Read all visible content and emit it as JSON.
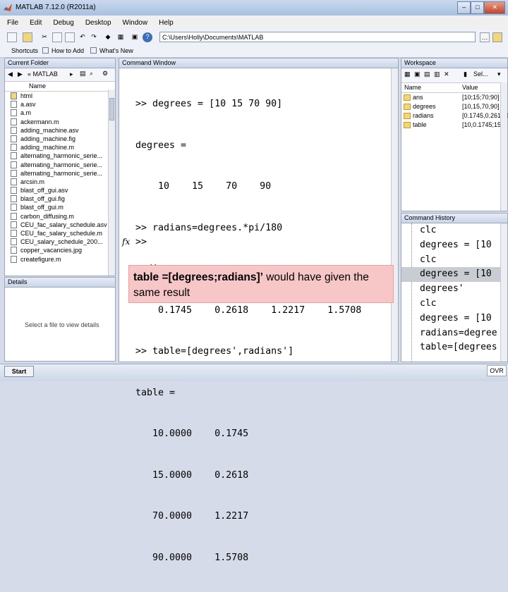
{
  "window": {
    "title": "MATLAB 7.12.0 (R2011a)"
  },
  "menu": [
    "File",
    "Edit",
    "Debug",
    "Desktop",
    "Window",
    "Help"
  ],
  "toolbar": {
    "path": "C:\\Users\\Holly\\Documents\\MATLAB"
  },
  "shortcuts": {
    "label": "Shortcuts",
    "how_to_add": "How to Add",
    "whats_new": "What's New"
  },
  "current_folder": {
    "title": "Current Folder",
    "breadcrumb": "« MATLAB",
    "column_header": "Name",
    "files": [
      "html",
      "a.asv",
      "a.m",
      "ackermann.m",
      "adding_machine.asv",
      "adding_machine.fig",
      "adding_machine.m",
      "alternating_harmonic_serie...",
      "alternating_harmonic_serie...",
      "alternating_harmonic_serie...",
      "arcsin.m",
      "blast_off_gui.asv",
      "blast_off_gui.fig",
      "blast_off_gui.m",
      "carbon_diffusing.m",
      "CEU_fac_salary_schedule.asv",
      "CEU_fac_salary_schedule.m",
      "CEU_salary_schedule_200...",
      "copper_vacancies.jpg",
      "createfigure.m"
    ]
  },
  "details": {
    "title": "Details",
    "placeholder": "Select a file to view details"
  },
  "command_window": {
    "title": "Command Window",
    "lines": [
      ">> degrees = [10 15 70 90]",
      "degrees =",
      "    10    15    70    90",
      ">> radians=degrees.*pi/180",
      "radians =",
      "    0.1745    0.2618    1.2217    1.5708",
      ">> table=[degrees',radians']",
      "table =",
      "   10.0000    0.1745",
      "   15.0000    0.2618",
      "   70.0000    1.2217",
      "   90.0000    1.5708"
    ],
    "fx": "fx",
    "prompt": ">>"
  },
  "note": {
    "bold": "table =[degrees;radians]’",
    "rest": " would have given the same result"
  },
  "workspace": {
    "title": "Workspace",
    "select_label": "Sel...",
    "columns": [
      "Name",
      "Value"
    ],
    "rows": [
      {
        "name": "ans",
        "value": "[10;15;70;90]"
      },
      {
        "name": "degrees",
        "value": "[10,15,70,90]"
      },
      {
        "name": "radians",
        "value": "[0.1745,0.2618,1..."
      },
      {
        "name": "table",
        "value": "[10,0.1745;15,0.2..."
      }
    ]
  },
  "history": {
    "title": "Command History",
    "lines": [
      "clc",
      "degrees = [10",
      "clc",
      "degrees = [10",
      "degrees'",
      "clc",
      "degrees = [10",
      "radians=degree",
      "table=[degrees"
    ]
  },
  "status": {
    "start": "Start",
    "ovr": "OVR"
  }
}
